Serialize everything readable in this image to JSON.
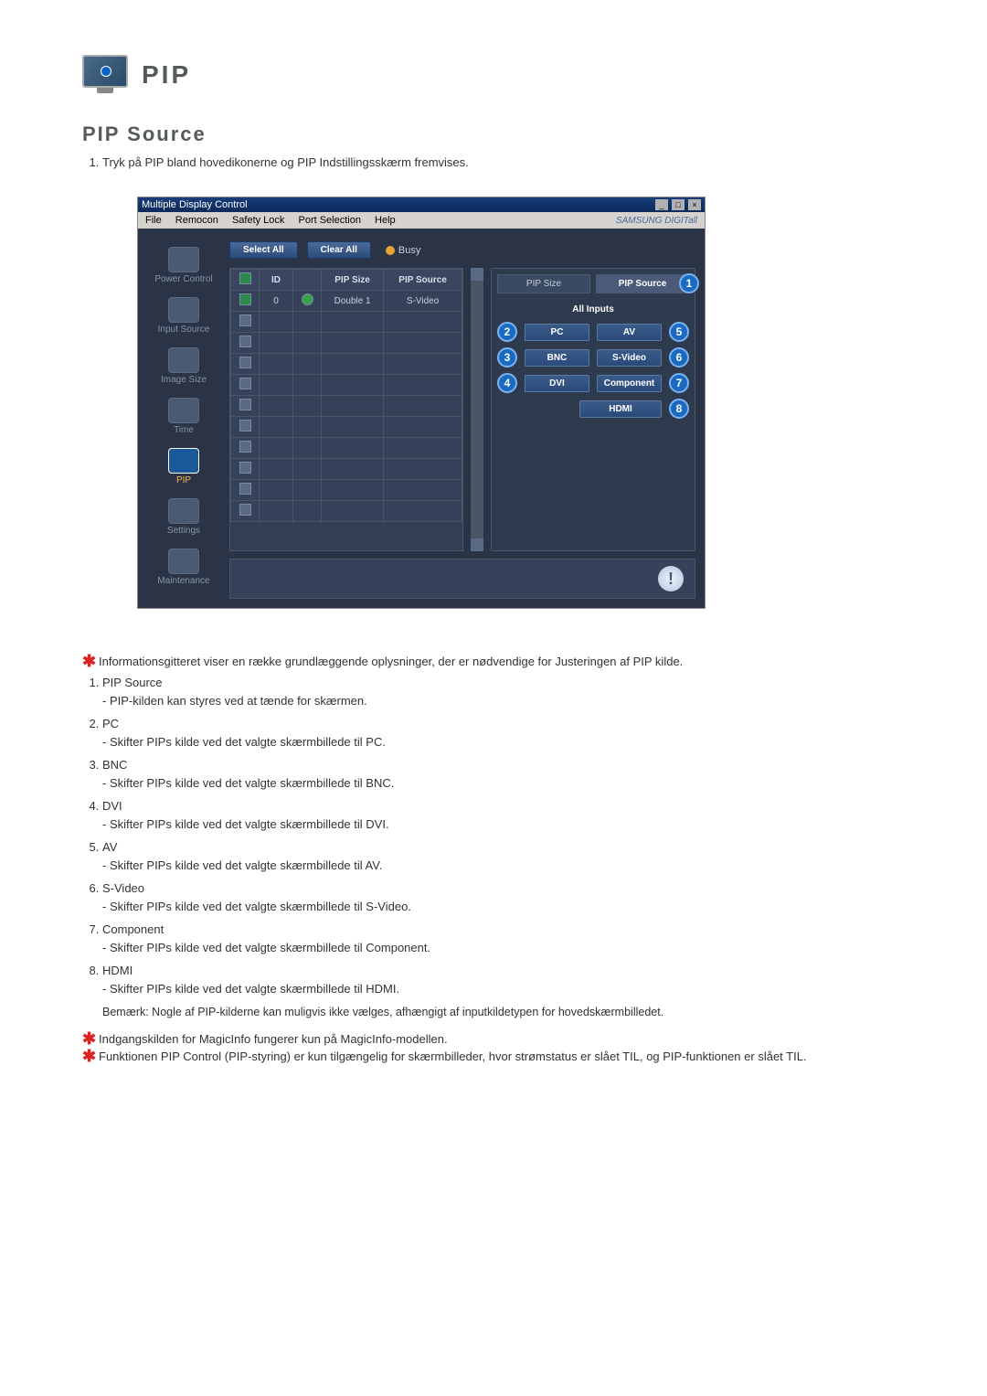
{
  "header": {
    "title": "PIP"
  },
  "section": {
    "heading": "PIP Source"
  },
  "intro": {
    "item1": "Tryk på PIP bland hovedikonerne og PIP Indstillingsskærm fremvises."
  },
  "window": {
    "title": "Multiple Display Control",
    "brand": "SAMSUNG DIGITall",
    "menu": {
      "file": "File",
      "remocon": "Remocon",
      "safety": "Safety Lock",
      "port": "Port Selection",
      "help": "Help"
    },
    "sidebar": {
      "power": "Power Control",
      "input": "Input Source",
      "image": "Image Size",
      "time": "Time",
      "pip": "PIP",
      "settings": "Settings",
      "maint": "Maintenance"
    },
    "topbar": {
      "selectall": "Select All",
      "clearall": "Clear All",
      "busy": "Busy"
    },
    "grid": {
      "h_chk": "",
      "h_id": "ID",
      "h_status": "",
      "h_pipsize": "PIP Size",
      "h_pipsource": "PIP Source",
      "row1_id": "0",
      "row1_size": "Double 1",
      "row1_src": "S-Video"
    },
    "panel": {
      "tab_pipsize": "PIP Size",
      "tab_pipsource": "PIP Source",
      "allinputs": "All Inputs",
      "pc": "PC",
      "av": "AV",
      "bnc": "BNC",
      "svideo": "S-Video",
      "dvi": "DVI",
      "component": "Component",
      "hdmi": "HDMI",
      "n1": "1",
      "n2": "2",
      "n3": "3",
      "n4": "4",
      "n5": "5",
      "n6": "6",
      "n7": "7",
      "n8": "8"
    }
  },
  "notes": {
    "top": "Informationsgitteret viser en række grundlæggende oplysninger, der er nødvendige for Justeringen af PIP kilde.",
    "items": {
      "t1": "PIP Source",
      "d1": "- PIP-kilden kan styres ved at tænde for skærmen.",
      "t2": "PC",
      "d2": "- Skifter PIPs kilde ved det valgte skærmbillede til PC.",
      "t3": "BNC",
      "d3": "- Skifter PIPs kilde ved det valgte skærmbillede til BNC.",
      "t4": "DVI",
      "d4": "- Skifter PIPs kilde ved det valgte skærmbillede til DVI.",
      "t5": "AV",
      "d5": "- Skifter PIPs kilde ved det valgte skærmbillede til AV.",
      "t6": "S-Video",
      "d6": "- Skifter PIPs kilde ved det valgte skærmbillede til S-Video.",
      "t7": "Component",
      "d7": "- Skifter PIPs kilde ved det valgte skærmbillede til Component.",
      "t8": "HDMI",
      "d8": "- Skifter PIPs kilde ved det valgte skærmbillede til HDMI."
    },
    "remark": "Bemærk: Nogle af PIP-kilderne kan muligvis ikke vælges, afhængigt af inputkildetypen for hovedskærmbilledet.",
    "magic": "Indgangskilden for MagicInfo fungerer kun på MagicInfo-modellen.",
    "control": "Funktionen PIP Control (PIP-styring) er kun tilgængelig for skærmbilleder, hvor strømstatus er slået TIL, og PIP-funktionen er slået TIL."
  }
}
